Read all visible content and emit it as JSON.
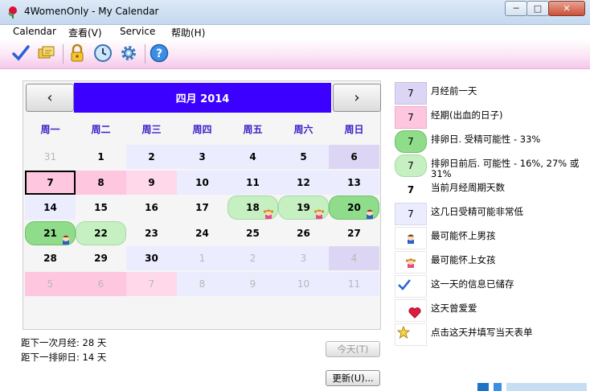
{
  "window": {
    "title": "4WomenOnly - My Calendar"
  },
  "window_controls": {
    "minimize": "─",
    "maximize": "□",
    "close": "✕"
  },
  "menu": [
    {
      "label": "Calendar"
    },
    {
      "label": "查看(V)"
    },
    {
      "label": "Service"
    },
    {
      "label": "帮助(H)"
    }
  ],
  "toolbar": {
    "icons": [
      "check-icon",
      "folders-icon",
      "lock-icon",
      "clock-icon",
      "gear-icon",
      "help-icon"
    ]
  },
  "calendar": {
    "prev": "‹",
    "next": "›",
    "month_title": "四月 2014",
    "weekdays": [
      "周一",
      "周二",
      "周三",
      "周四",
      "周五",
      "周六",
      "周日"
    ],
    "rows": [
      [
        {
          "d": "31",
          "o": true,
          "t": ""
        },
        {
          "d": "1",
          "o": false,
          "t": ""
        },
        {
          "d": "2",
          "o": false,
          "t": "fert"
        },
        {
          "d": "3",
          "o": false,
          "t": "fert"
        },
        {
          "d": "4",
          "o": false,
          "t": "fert"
        },
        {
          "d": "5",
          "o": false,
          "t": "fert"
        },
        {
          "d": "6",
          "o": false,
          "t": "pre"
        }
      ],
      [
        {
          "d": "7",
          "o": false,
          "t": "per today"
        },
        {
          "d": "8",
          "o": false,
          "t": "per"
        },
        {
          "d": "9",
          "o": false,
          "t": "per2"
        },
        {
          "d": "10",
          "o": false,
          "t": "fert"
        },
        {
          "d": "11",
          "o": false,
          "t": "fert"
        },
        {
          "d": "12",
          "o": false,
          "t": "fert"
        },
        {
          "d": "13",
          "o": false,
          "t": "fert"
        }
      ],
      [
        {
          "d": "14",
          "o": false,
          "t": "fert"
        },
        {
          "d": "15",
          "o": false,
          "t": ""
        },
        {
          "d": "16",
          "o": false,
          "t": ""
        },
        {
          "d": "17",
          "o": false,
          "t": ""
        },
        {
          "d": "18",
          "o": false,
          "t": "ovp",
          "k": "girl"
        },
        {
          "d": "19",
          "o": false,
          "t": "ovp",
          "k": "girl"
        },
        {
          "d": "20",
          "o": false,
          "t": "ov",
          "k": "boy"
        }
      ],
      [
        {
          "d": "21",
          "o": false,
          "t": "ov",
          "k": "boy"
        },
        {
          "d": "22",
          "o": false,
          "t": "ovp"
        },
        {
          "d": "23",
          "o": false,
          "t": ""
        },
        {
          "d": "24",
          "o": false,
          "t": ""
        },
        {
          "d": "25",
          "o": false,
          "t": ""
        },
        {
          "d": "26",
          "o": false,
          "t": ""
        },
        {
          "d": "27",
          "o": false,
          "t": ""
        }
      ],
      [
        {
          "d": "28",
          "o": false,
          "t": ""
        },
        {
          "d": "29",
          "o": false,
          "t": ""
        },
        {
          "d": "30",
          "o": false,
          "t": "fert"
        },
        {
          "d": "1",
          "o": true,
          "t": "fert"
        },
        {
          "d": "2",
          "o": true,
          "t": "fert"
        },
        {
          "d": "3",
          "o": true,
          "t": "fert"
        },
        {
          "d": "4",
          "o": true,
          "t": "pre"
        }
      ],
      [
        {
          "d": "5",
          "o": true,
          "t": "per"
        },
        {
          "d": "6",
          "o": true,
          "t": "per"
        },
        {
          "d": "7",
          "o": true,
          "t": "per2"
        },
        {
          "d": "8",
          "o": true,
          "t": "fert"
        },
        {
          "d": "9",
          "o": true,
          "t": "fert"
        },
        {
          "d": "10",
          "o": true,
          "t": "fert"
        },
        {
          "d": "11",
          "o": true,
          "t": "fert"
        }
      ]
    ]
  },
  "info": {
    "next_period": "距下一次月经: 28 天",
    "next_ovulation": "距下一排卵日: 14 天"
  },
  "buttons": {
    "today": "今天(T)",
    "update": "更新(U)..."
  },
  "legend": [
    {
      "box": "7",
      "style": "pre",
      "label": "月经前一天"
    },
    {
      "box": "7",
      "style": "per",
      "label": "经期(出血的日子)"
    },
    {
      "box": "7",
      "style": "ov",
      "label": "排卵日. 受精可能性 - 33%"
    },
    {
      "box": "7",
      "style": "ovp",
      "label": "排卵日前后. 可能性 - 16%, 27% 或 31%"
    },
    {
      "box": "7",
      "style": "today",
      "label": "当前月经周期天数"
    },
    {
      "box": "7",
      "style": "fert",
      "label": "这几日受精可能非常低"
    },
    {
      "box": "",
      "style": "boy",
      "label": "最可能怀上男孩"
    },
    {
      "box": "",
      "style": "girl",
      "label": "最可能怀上女孩"
    },
    {
      "box": "",
      "style": "check",
      "label": "这一天的信息已储存"
    },
    {
      "box": "",
      "style": "heart",
      "label": "这天曾爱爱"
    },
    {
      "box": "",
      "style": "star",
      "label": "点击这天并填写当天表单"
    }
  ],
  "colors": {
    "month_bar": "#3b00ff",
    "weekday_text": "#3c1fc8",
    "period": "#ffc6e0",
    "ovulation": "#8fdc8a",
    "near_ovulation": "#c6f0c2",
    "low_fertility": "#ececff"
  }
}
